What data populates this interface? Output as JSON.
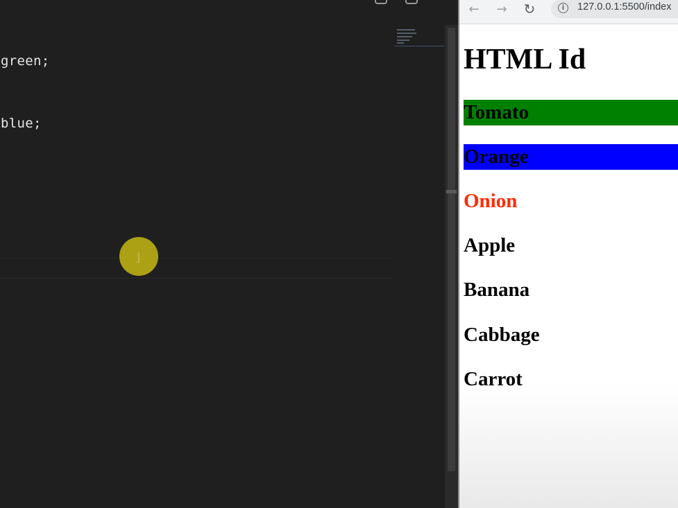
{
  "editor": {
    "code_lines": [
      "green;",
      "blue;"
    ],
    "click_indicator_label": "J"
  },
  "browser": {
    "url": "127.0.0.1:5500/index",
    "nav": {
      "back": "←",
      "forward": "→",
      "reload": "↻",
      "info": "i"
    },
    "page": {
      "title": "HTML Id",
      "items": [
        {
          "label": "Tomato",
          "background": "#008000",
          "color": "#000000"
        },
        {
          "label": "Orange",
          "background": "#0000ff",
          "color": "#000000"
        },
        {
          "label": "Onion",
          "color": "#ff2b00"
        },
        {
          "label": "Apple"
        },
        {
          "label": "Banana"
        },
        {
          "label": "Cabbage"
        },
        {
          "label": "Carrot"
        }
      ]
    }
  },
  "colors": {
    "editor_bg": "#1f1f1f",
    "click_indicator": "#b9ab15",
    "browser_bg": "#ffffff"
  },
  "icons": [
    "back-arrow-icon",
    "forward-arrow-icon",
    "reload-icon",
    "site-info-icon"
  ]
}
